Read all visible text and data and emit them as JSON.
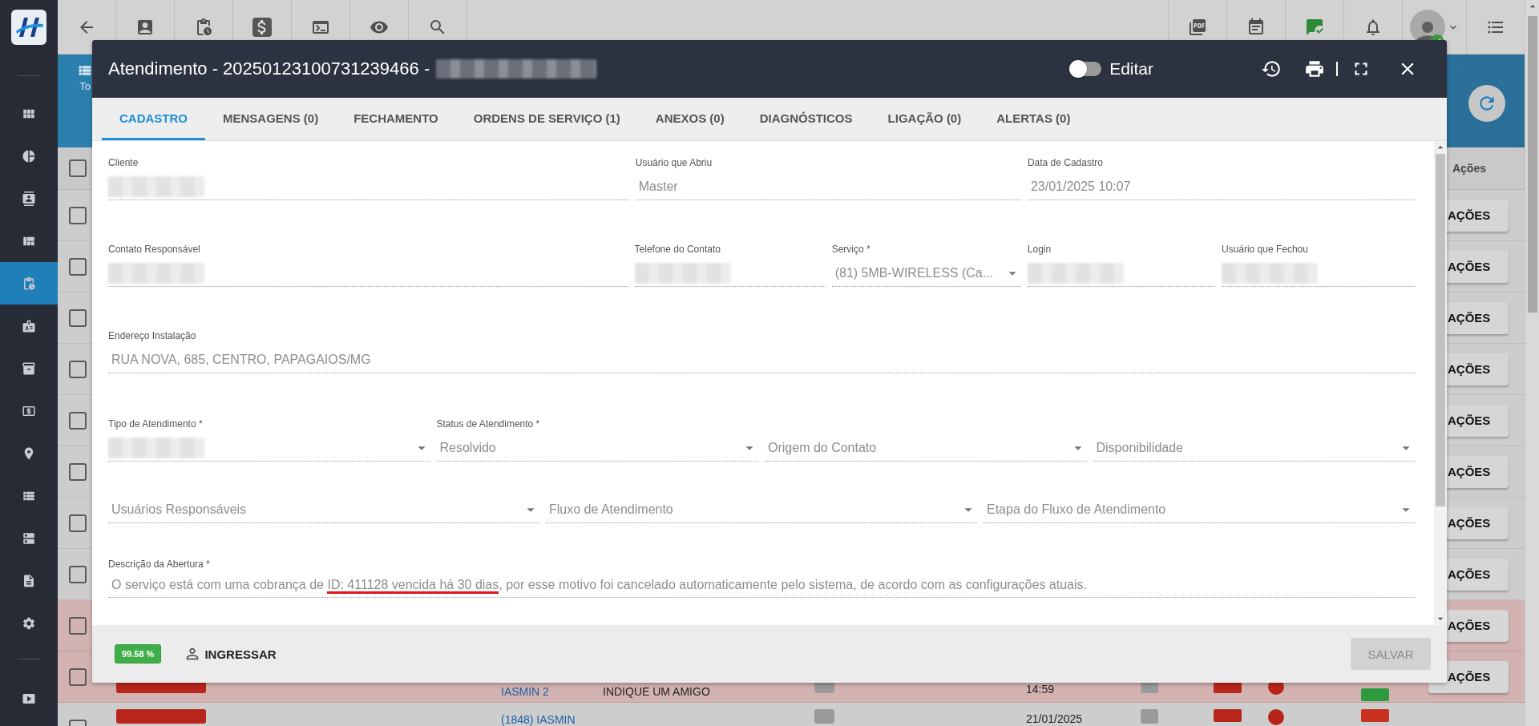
{
  "sidebar": {
    "items": [
      {
        "selected": false
      },
      {
        "selected": false
      },
      {
        "selected": false
      },
      {
        "selected": false
      },
      {
        "selected": true
      },
      {
        "selected": false
      },
      {
        "selected": false
      },
      {
        "selected": false
      },
      {
        "selected": false
      },
      {
        "selected": false
      },
      {
        "selected": false
      },
      {
        "selected": false
      },
      {
        "selected": false
      }
    ]
  },
  "banner": {
    "label": "To"
  },
  "background_table": {
    "header": "Ações",
    "all_checked": false,
    "rows": [
      {
        "highlighted": false,
        "checked": false,
        "action": "AÇÕES"
      },
      {
        "highlighted": false,
        "checked": false,
        "action": "AÇÕES"
      },
      {
        "highlighted": false,
        "checked": false,
        "action": "AÇÕES"
      },
      {
        "highlighted": false,
        "checked": false,
        "action": "AÇÕES"
      },
      {
        "highlighted": false,
        "checked": false,
        "action": "AÇÕES"
      },
      {
        "highlighted": false,
        "checked": false,
        "action": "AÇÕES"
      },
      {
        "highlighted": false,
        "checked": false,
        "action": "AÇÕES"
      },
      {
        "highlighted": false,
        "checked": false,
        "action": "AÇÕES"
      },
      {
        "highlighted": true,
        "checked": false,
        "action": "AÇÕES"
      },
      {
        "highlighted": true,
        "checked": false,
        "action": "AÇÕES",
        "link": "IASMIN 2",
        "service": "INDIQUE UM AMIGO",
        "date": "14:59",
        "color": "#2e9a3e"
      },
      {
        "highlighted": false,
        "checked": false,
        "link": "(1848) IASMIN",
        "date": "21/01/2025",
        "color": "#c8321f"
      }
    ]
  },
  "modal": {
    "title": "Atendimento - 20250123100731239466 -",
    "title_redacted": true,
    "edit_toggle": {
      "label": "Editar",
      "on": false
    },
    "tabs": [
      {
        "label": "CADASTRO",
        "selected": true
      },
      {
        "label": "MENSAGENS (0)",
        "selected": false
      },
      {
        "label": "FECHAMENTO",
        "selected": false
      },
      {
        "label": "ORDENS DE SERVIÇO (1)",
        "selected": false
      },
      {
        "label": "ANEXOS (0)",
        "selected": false
      },
      {
        "label": "DIAGNÓSTICOS",
        "selected": false
      },
      {
        "label": "LIGAÇÃO (0)",
        "selected": false
      },
      {
        "label": "ALERTAS (0)",
        "selected": false
      }
    ],
    "form_rows": [
      [
        {
          "kind": "text",
          "label": "Cliente",
          "redacted": true
        },
        {
          "kind": "text",
          "label": "Usuário que Abriu",
          "value": "Master"
        },
        {
          "kind": "text",
          "label": "Data de Cadastro",
          "value": "23/01/2025 10:07"
        }
      ],
      [
        {
          "kind": "text",
          "label": "Contato Responsável",
          "redacted": true
        },
        {
          "kind": "text",
          "label": "Telefone do Contato",
          "redacted": true
        },
        {
          "kind": "select",
          "label": "Serviço *",
          "value": "(81) 5MB-WIRELESS (Ca..."
        },
        {
          "kind": "text",
          "label": "Login",
          "redacted": true
        },
        {
          "kind": "text",
          "label": "Usuário que Fechou",
          "redacted": true
        }
      ],
      [
        {
          "kind": "text",
          "label": "Endereço Instalação",
          "value": "RUA NOVA, 685, CENTRO, PAPAGAIOS/MG"
        }
      ],
      [
        {
          "kind": "select",
          "label": "Tipo de Atendimento *",
          "redacted": true
        },
        {
          "kind": "select",
          "label": "Status de Atendimento *",
          "value": "Resolvido"
        },
        {
          "kind": "select",
          "placeholder": "Origem do Contato"
        },
        {
          "kind": "select",
          "placeholder": "Disponibilidade"
        }
      ],
      [
        {
          "kind": "select",
          "placeholder": "Usuários Responsáveis"
        },
        {
          "kind": "select",
          "placeholder": "Fluxo de Atendimento"
        },
        {
          "kind": "select",
          "placeholder": "Etapa do Fluxo de Atendimento"
        }
      ]
    ],
    "description": {
      "label": "Descrição da Abertura *",
      "before": "O serviço está com uma cobrança de ",
      "marked": "ID: 411128 vencida há 30 dias",
      "after": ", por esse motivo foi cancelado automaticamente pelo sistema, de acordo com as configurações atuais."
    },
    "footer": {
      "score": "99.58 %",
      "join_label": "INGRESSAR",
      "save_label": "SALVAR",
      "save_disabled": true
    }
  }
}
